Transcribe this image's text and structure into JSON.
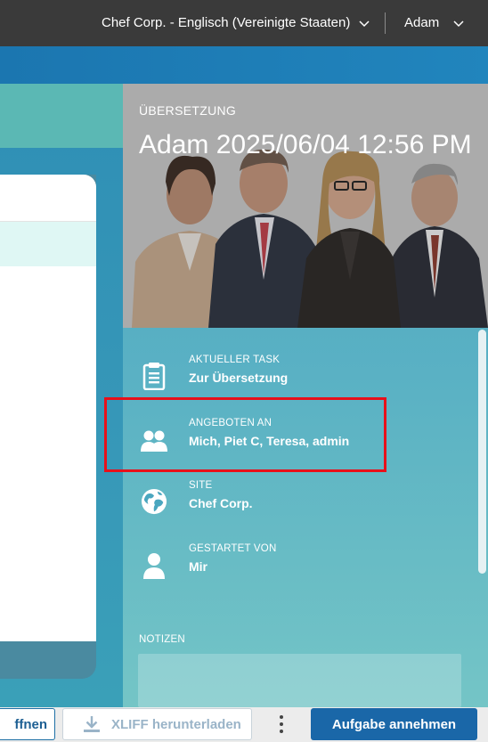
{
  "topbar": {
    "org_selector": "Chef Corp. - Englisch (Vereinigte Staaten)",
    "user_menu": "Adam"
  },
  "hero": {
    "label": "ÜBERSETZUNG",
    "title": "Adam 2025/06/04 12:56 PM"
  },
  "info": [
    {
      "icon": "clipboard-icon",
      "label": "AKTUELLER TASK",
      "value": "Zur Übersetzung"
    },
    {
      "icon": "group-icon",
      "label": "ANGEBOTEN AN",
      "value": "Mich, Piet C, Teresa, admin"
    },
    {
      "icon": "globe-icon",
      "label": "SITE",
      "value": "Chef Corp."
    },
    {
      "icon": "user-icon",
      "label": "GESTARTET VON",
      "value": "Mir"
    }
  ],
  "notes": {
    "label": "NOTIZEN"
  },
  "footer": {
    "open_button": "ffnen",
    "xliff_button": "XLIFF herunterladen",
    "accept_button": "Aufgabe annehmen"
  },
  "colors": {
    "topbar": "#3a3a3a",
    "accent_blue": "#1a67a8",
    "highlight_red": "#e8101a"
  }
}
